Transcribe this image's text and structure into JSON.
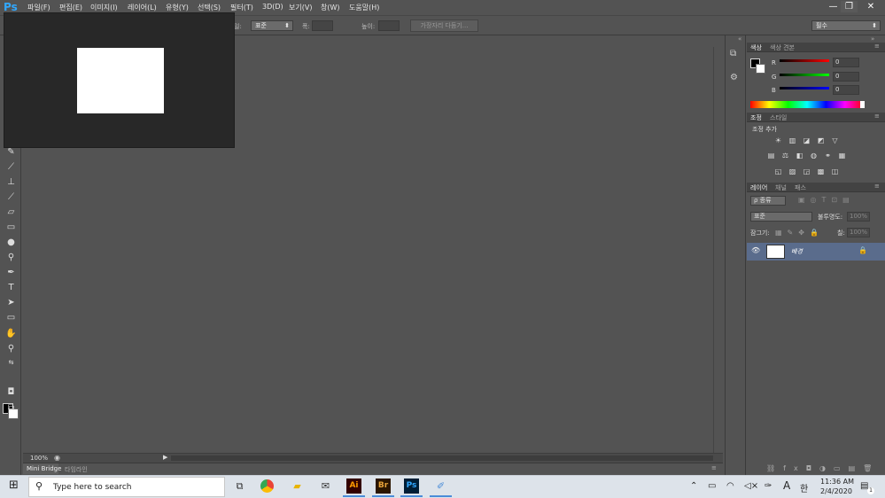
{
  "app": {
    "logo": "Ps"
  },
  "menu": [
    "파일(F)",
    "편집(E)",
    "이미지(I)",
    "레이어(L)",
    "유형(Y)",
    "선택(S)",
    "필터(T)",
    "3D(D)",
    "보기(V)",
    "창(W)",
    "도움말(H)"
  ],
  "window_controls": {
    "minimize": "—",
    "restore": "❐",
    "close": "✕"
  },
  "options": {
    "style_label": "일:",
    "style_value": "표준",
    "width_label": "폭:",
    "width_value": "",
    "height_label": "높이:",
    "height_value": "",
    "refine_button": "가장자리 다듬기...",
    "workspace_value": "필수"
  },
  "document": {
    "zoom": "100%"
  },
  "bottom_tabs": [
    "Mini Bridge",
    "타임라인"
  ],
  "color_panel": {
    "tabs": [
      "색상",
      "색상 견본"
    ],
    "channels": [
      {
        "label": "R",
        "value": "0",
        "color": "#d02020"
      },
      {
        "label": "G",
        "value": "0",
        "color": "#20c020"
      },
      {
        "label": "B",
        "value": "0",
        "color": "#2040e0"
      }
    ]
  },
  "adjust_panel": {
    "tabs": [
      "조정",
      "스타일"
    ],
    "heading": "조정 추가"
  },
  "layers_panel": {
    "tabs": [
      "레이어",
      "채널",
      "패스"
    ],
    "filter_value": "ρ 종류",
    "blend_value": "표준",
    "opacity_label": "불투명도:",
    "opacity_value": "100%",
    "lock_label": "잠그기:",
    "fill_label": "칠:",
    "fill_value": "100%",
    "layers": [
      {
        "name": "배경",
        "visible_icon": "eye-icon",
        "locked": true
      }
    ]
  },
  "taskbar": {
    "search_placeholder": "Type here to search",
    "apps": [
      "task-view-icon",
      "chrome-icon",
      "file-explorer-icon",
      "mail-icon",
      "illustrator-icon",
      "bridge-icon",
      "photoshop-icon",
      "paint-icon"
    ],
    "ai_label": "Ai",
    "br_label": "Br",
    "ps_label": "Ps",
    "ime": "A",
    "lang": "한",
    "time": "11:36 AM",
    "date": "2/4/2020",
    "notification_count": "1"
  }
}
